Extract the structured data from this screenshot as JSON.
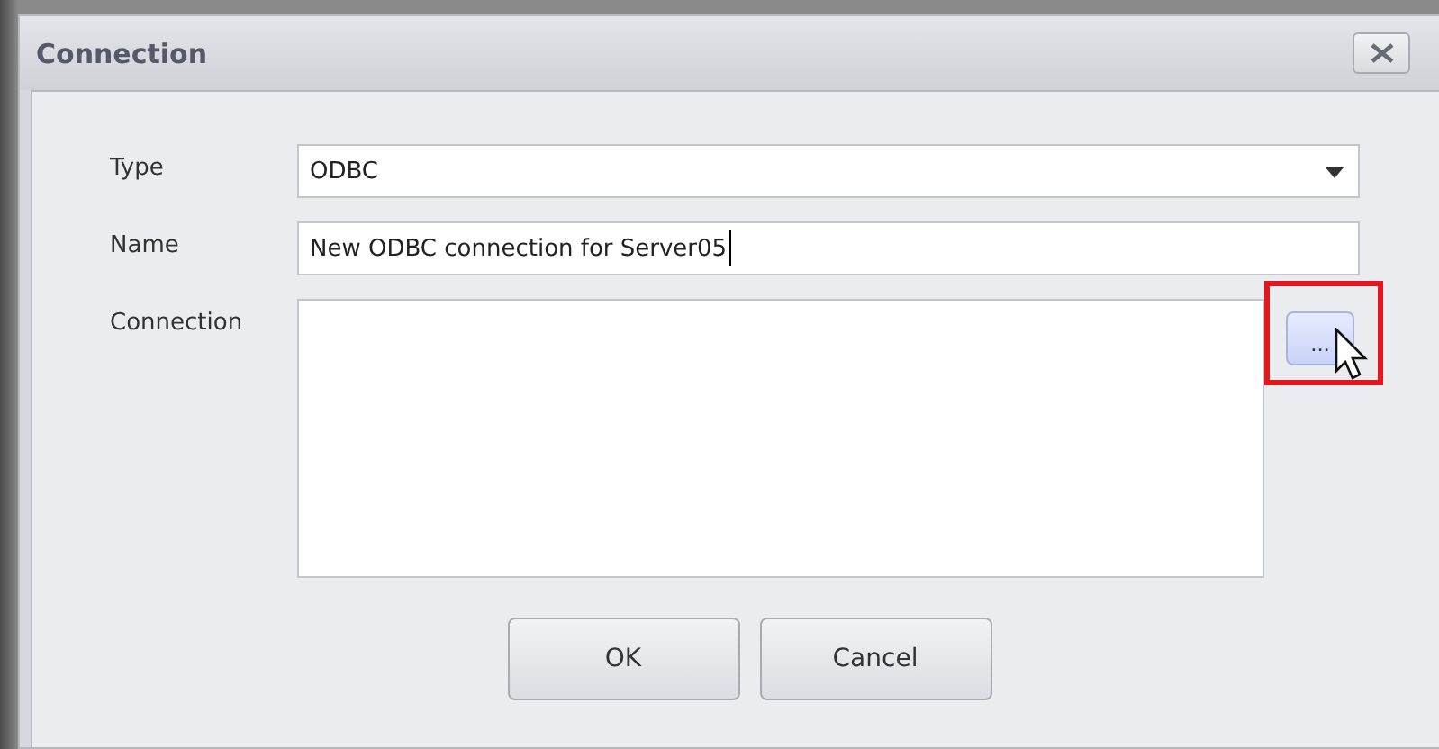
{
  "window": {
    "title": "Connection"
  },
  "fields": [
    {
      "kind": "dropdown",
      "label": "Type",
      "value": "ODBC"
    },
    {
      "kind": "text",
      "label": "Name",
      "value": "New ODBC connection for Server05",
      "focused": true
    },
    {
      "kind": "memo",
      "label": "Connection",
      "browse_button": "...",
      "highlighted": true
    }
  ],
  "buttons": [
    "OK",
    "Cancel"
  ]
}
